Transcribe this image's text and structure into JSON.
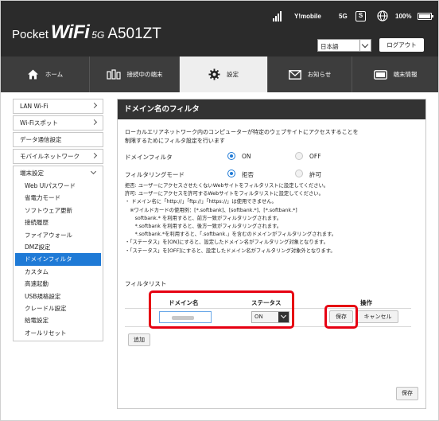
{
  "header": {
    "brand_pocket": "Pocket",
    "brand_wifi": "WiFi",
    "brand_5g": "5G",
    "brand_model": "A501ZT",
    "carrier": "Y!mobile",
    "network": "5G",
    "sms_label": "S",
    "battery": "100%",
    "language": "日本語",
    "logout_label": "ログアウト"
  },
  "tabs": [
    {
      "label": "ホーム",
      "icon": "home-icon"
    },
    {
      "label": "接続中の端末",
      "icon": "devices-icon"
    },
    {
      "label": "設定",
      "icon": "gear-icon"
    },
    {
      "label": "お知らせ",
      "icon": "mail-icon"
    },
    {
      "label": "端末情報",
      "icon": "device-info-icon"
    }
  ],
  "sidebar": {
    "items": [
      {
        "label": "LAN Wi-Fi",
        "chevron": true
      },
      {
        "label": "Wi-Fiスポット",
        "chevron": true
      },
      {
        "label": "データ通信設定",
        "chevron": false
      },
      {
        "label": "モバイルネットワーク",
        "chevron": true
      }
    ],
    "group_label": "端末設定",
    "sub_items": [
      "Web UIパスワード",
      "省電力モード",
      "ソフトウェア更新",
      "接続履歴",
      "ファイアウォール",
      "DMZ設定",
      "ドメインフィルタ",
      "カスタム",
      "高速起動",
      "USB規格設定",
      "クレードル設定",
      "給電設定",
      "オールリセット"
    ],
    "active_sub": "ドメインフィルタ"
  },
  "main": {
    "title": "ドメイン名のフィルタ",
    "desc_line1": "ローカルエリアネットワーク内のコンピューターが特定のウェブサイトにアクセスすることを",
    "desc_line2": "制限するためにフィルタ設定を行います",
    "domain_filter_label": "ドメインフィルタ",
    "domain_filter_on": "ON",
    "domain_filter_off": "OFF",
    "filtering_mode_label": "フィルタリングモード",
    "mode_reject": "拒否",
    "mode_allow": "許可",
    "notes": [
      "拒否: ユーザーにアクセスさせたくないWebサイトをフィルタリストに設定してください。",
      "許可: ユーザーにアクセスを許可するWebサイトをフィルタリストに設定してください。",
      "・ ドメイン名に「http://」「ftp://」「https://」は使用できません。",
      "　※ワイルドカードの使用例：[*.softbank]、[softbank.*]、[*.softbank.*]",
      "　　softbank.* を利用すると、前方一致がフィルタリングされます。",
      "　　*.softbank を利用すると、後方一致がフィルタリングされます。",
      "　　*.softbank.*を利用すると、「.softbank.」を含むのドメインがフィルタリングされます。",
      "・「ステータス」を[ON]にすると、設定したドメイン名がフィルタリング対象となります。",
      "・「ステータス」を[OFF]にすると、設定したドメイン名がフィルタリング対象外となります。"
    ],
    "filter_list_label": "フィルタリスト",
    "col_domain": "ドメイン名",
    "col_status": "ステータス",
    "col_action": "操作",
    "status_value": "ON",
    "save_row_label": "保存",
    "cancel_label": "キャンセル",
    "add_label": "追加",
    "save_label": "保存"
  }
}
